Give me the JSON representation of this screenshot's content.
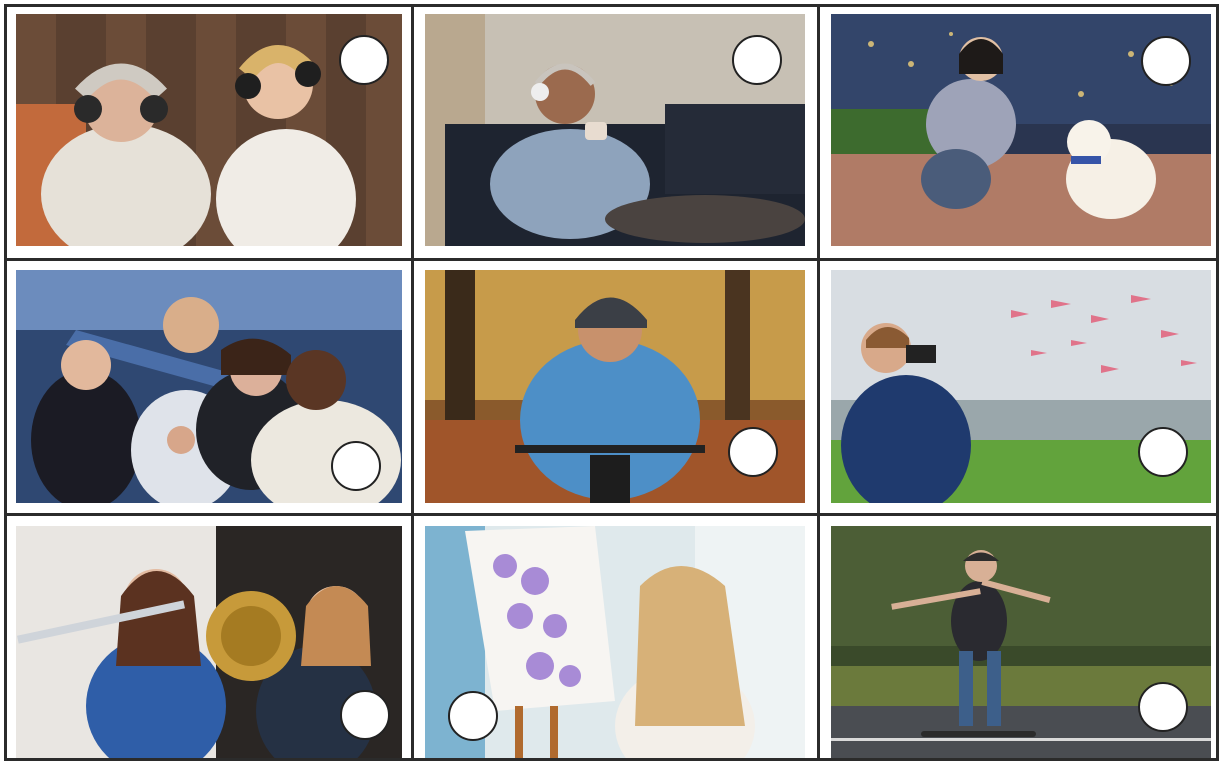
{
  "photos": [
    {
      "subject": "grandmother-and-girl-listening-to-headphones"
    },
    {
      "subject": "man-with-headphones-drinking-coffee-on-sofa"
    },
    {
      "subject": "girl-photographing-dog-in-city-at-night"
    },
    {
      "subject": "cheering-sports-fans"
    },
    {
      "subject": "smiling-cyclist-in-autumn-forest"
    },
    {
      "subject": "boy-with-binoculars-watching-flamingos"
    },
    {
      "subject": "girls-playing-flute-and-tuba"
    },
    {
      "subject": "girl-painting-flowers-on-easel"
    },
    {
      "subject": "girl-skateboarding-on-road"
    }
  ],
  "answer_circles": [
    "",
    "",
    "",
    "",
    "",
    "",
    "",
    "",
    ""
  ]
}
